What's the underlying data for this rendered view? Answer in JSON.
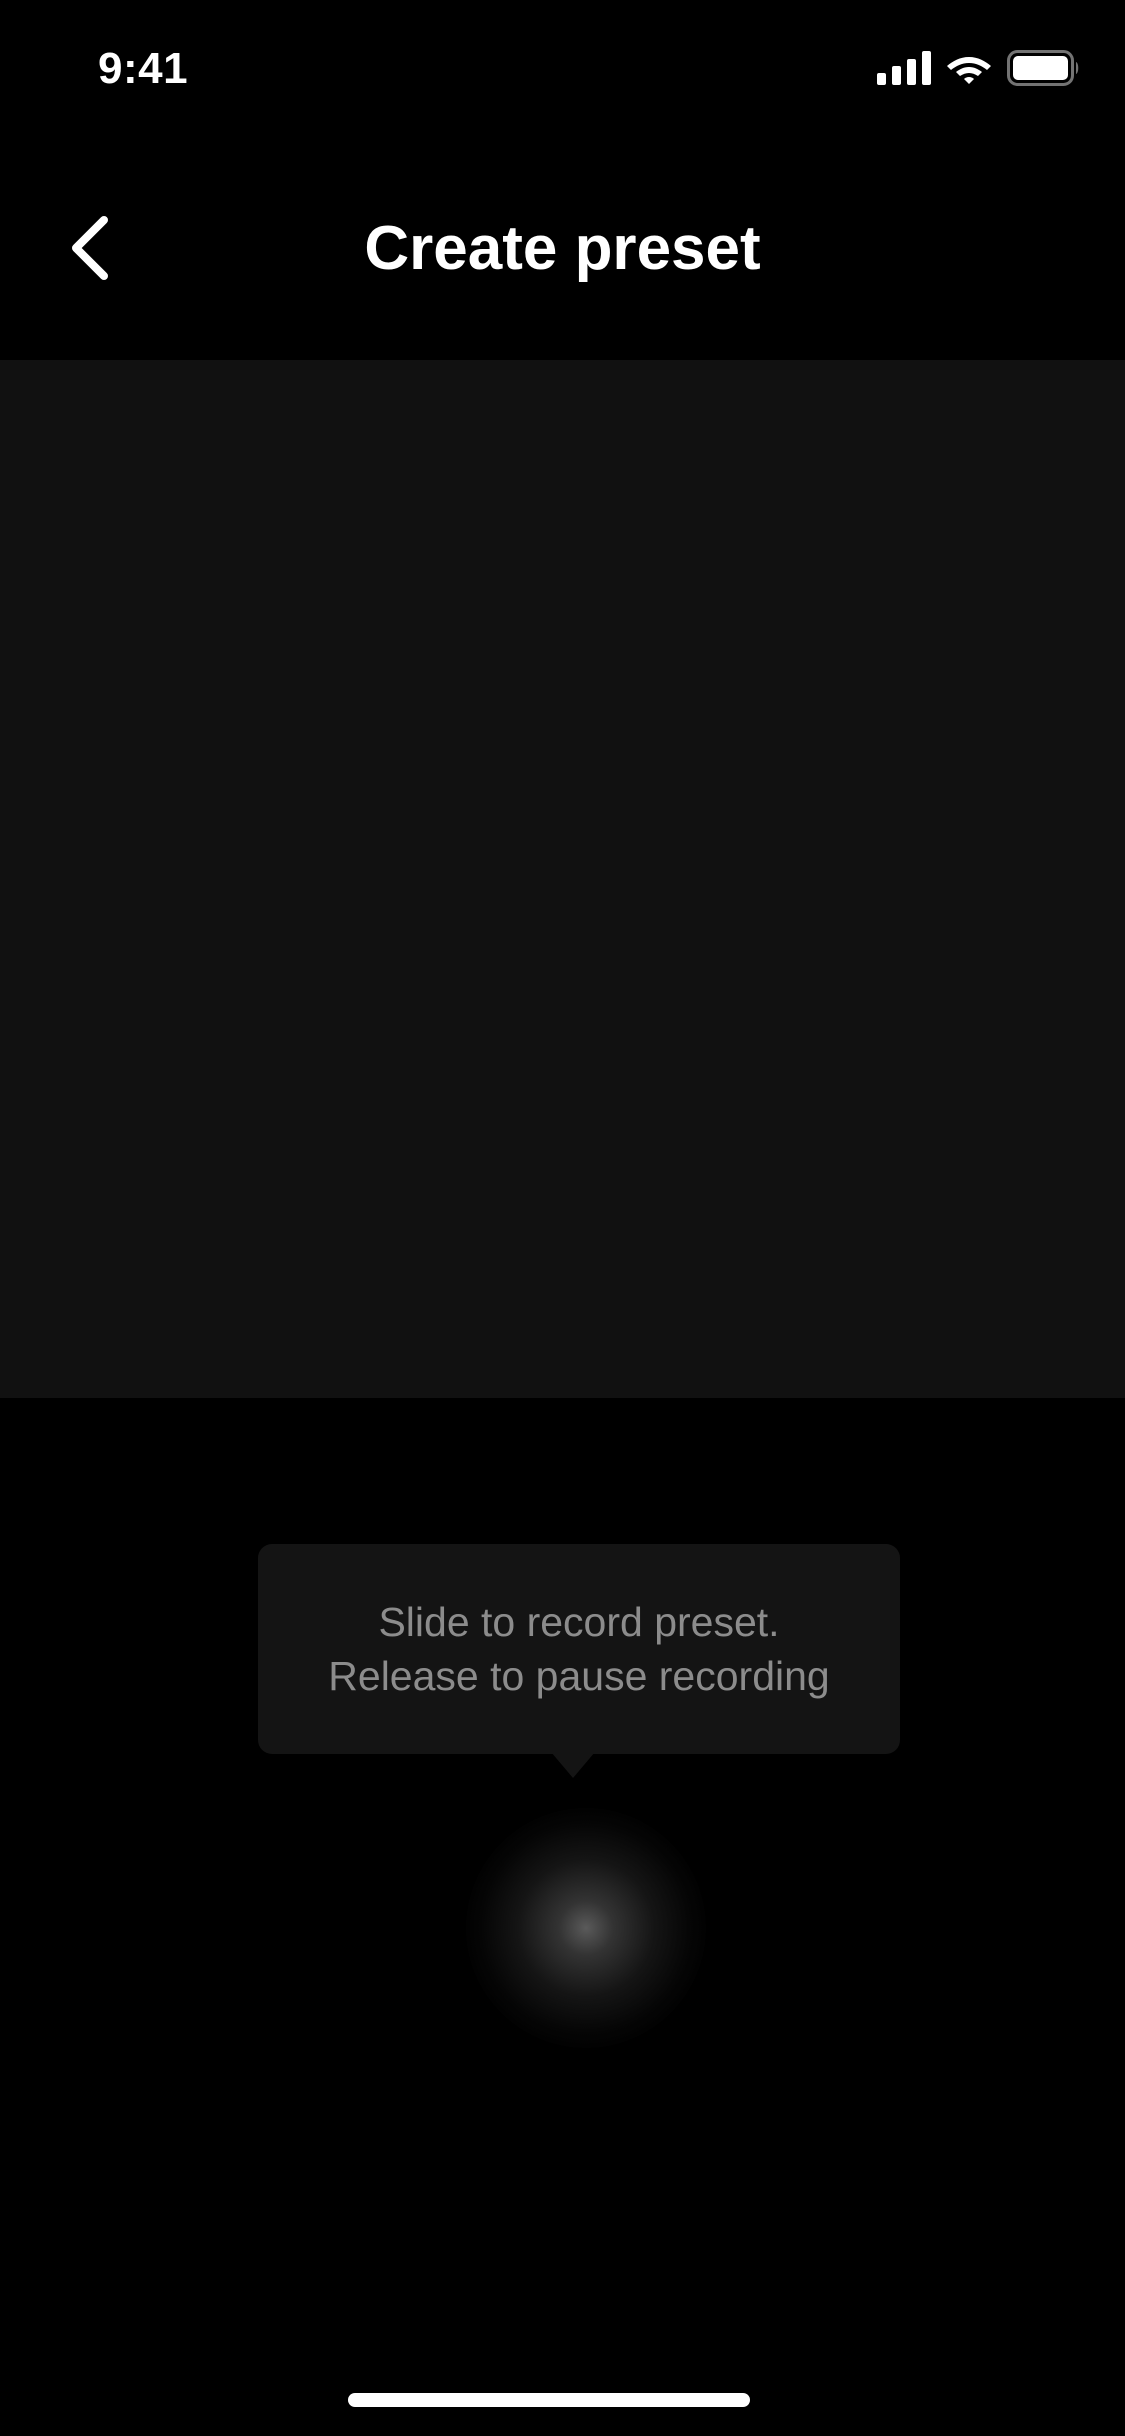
{
  "status_bar": {
    "time": "9:41",
    "icons": [
      "cellular-signal-icon",
      "wifi-icon",
      "battery-icon"
    ]
  },
  "nav": {
    "back_icon": "chevron-left-icon",
    "title": "Create preset"
  },
  "tooltip": {
    "line1": "Slide to record preset.",
    "line2": "Release to pause recording"
  },
  "colors": {
    "background": "#000000",
    "preview_area": "#111111",
    "tooltip_bg": "#141414",
    "tooltip_text": "#8c8c8c",
    "title_text": "#ffffff"
  }
}
